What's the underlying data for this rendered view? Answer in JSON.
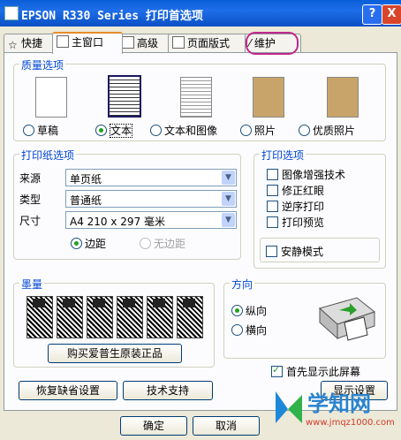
{
  "window": {
    "title": "EPSON R330 Series 打印首选项",
    "help": "?",
    "close": "X"
  },
  "tabs": [
    {
      "label": "快捷"
    },
    {
      "label": "主窗口"
    },
    {
      "label": "高级"
    },
    {
      "label": "页面版式"
    },
    {
      "label": "维护"
    }
  ],
  "quality": {
    "group_label": "质量选项",
    "options": [
      {
        "label": "草稿",
        "selected": false
      },
      {
        "label": "文本",
        "selected": true
      },
      {
        "label": "文本和图像",
        "selected": false
      },
      {
        "label": "照片",
        "selected": false
      },
      {
        "label": "优质照片",
        "selected": false
      }
    ]
  },
  "paper": {
    "group_label": "打印纸选项",
    "source_label": "来源",
    "source_value": "单页纸",
    "type_label": "类型",
    "type_value": "普通纸",
    "size_label": "尺寸",
    "size_value": "A4 210 x 297 毫米",
    "margin_label": "边距",
    "borderless_label": "无边距"
  },
  "print_options": {
    "group_label": "打印选项",
    "items": [
      {
        "label": "图像增强技术",
        "checked": false
      },
      {
        "label": "修正红眼",
        "checked": false
      },
      {
        "label": "逆序打印",
        "checked": false
      },
      {
        "label": "打印预览",
        "checked": false
      }
    ],
    "quiet_label": "安静模式"
  },
  "ink": {
    "group_label": "墨量",
    "buy_button": "购买爱普生原装正品",
    "cartridge_count": 6
  },
  "orientation": {
    "group_label": "方向",
    "portrait": "纵向",
    "landscape": "横向"
  },
  "show_first": "首先显示此屏幕",
  "buttons": {
    "restore": "恢复缺省设置",
    "support": "技术支持",
    "display": "显示设置",
    "ok": "确定",
    "cancel": "取消"
  },
  "watermark": {
    "text": "学知网",
    "url": "www.jmqz1000.com"
  }
}
